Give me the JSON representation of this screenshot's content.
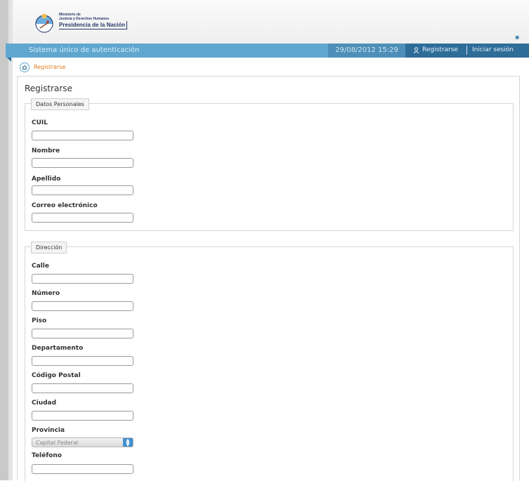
{
  "header": {
    "logo": {
      "line1": "Ministerio de",
      "line2": "Justicia y Derechos Humanos",
      "line3": "Presidencia de la Nación"
    }
  },
  "topbar": {
    "title": "Sistema único de autenticación",
    "datetime": "29/08/2012 15:29",
    "register_link": "Registrarse",
    "login_link": "Iniciar sesión"
  },
  "breadcrumb": {
    "current": "Registrarse"
  },
  "page": {
    "title": "Registrarse"
  },
  "personal": {
    "legend": "Datos Personales",
    "cuil_label": "CUIL",
    "nombre_label": "Nombre",
    "apellido_label": "Apellido",
    "correo_label": "Correo electrónico"
  },
  "address": {
    "legend": "Dirección",
    "calle_label": "Calle",
    "numero_label": "Número",
    "piso_label": "Piso",
    "departamento_label": "Departamento",
    "codigo_postal_label": "Código Postal",
    "ciudad_label": "Ciudad",
    "provincia_label": "Provincia",
    "provincia_value": "Capital Federal",
    "telefono_label": "Teléfono"
  },
  "colors": {
    "topbar": "#5fa7cf",
    "topbar_dark": "#2e6d98",
    "breadcrumb_link": "#e07b1e"
  },
  "icons": [
    "argentine-seal-icon",
    "user-icon",
    "home-icon",
    "select-arrows-icon"
  ]
}
